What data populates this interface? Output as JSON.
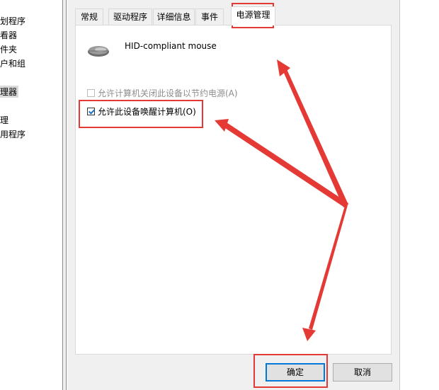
{
  "background_window": {
    "items": [
      {
        "label": "划程序",
        "selected": false
      },
      {
        "label": "看器",
        "selected": false
      },
      {
        "label": "件夹",
        "selected": false
      },
      {
        "label": "户和组",
        "selected": false
      },
      {
        "label": "理器",
        "selected": true
      },
      {
        "label": "理",
        "selected": false
      },
      {
        "label": "用程序",
        "selected": false
      }
    ]
  },
  "dialog": {
    "tabs": [
      {
        "label": "常规"
      },
      {
        "label": "驱动程序"
      },
      {
        "label": "详细信息"
      },
      {
        "label": "事件"
      },
      {
        "label": "电源管理"
      }
    ],
    "active_tab": "电源管理",
    "device": {
      "name": "HID-compliant mouse",
      "icon": "mouse-icon"
    },
    "options": [
      {
        "label": "允许计算机关闭此设备以节约电源(A)",
        "checked": false,
        "enabled": false
      },
      {
        "label": "允许此设备唤醒计算机(O)",
        "checked": true,
        "enabled": true
      }
    ],
    "buttons": {
      "ok": "确定",
      "cancel": "取消"
    }
  },
  "annotation": {
    "color": "#e53935"
  }
}
